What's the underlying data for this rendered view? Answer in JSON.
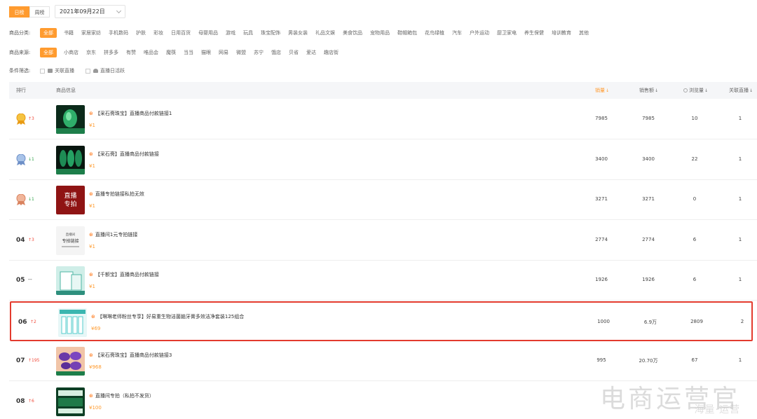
{
  "period": {
    "daily": "日榜",
    "weekly": "周榜"
  },
  "date": {
    "value": "2021年09月22日"
  },
  "category": {
    "label": "商品分类:",
    "items": [
      "全部",
      "书籍",
      "家居家纺",
      "手机数码",
      "护肤",
      "彩妆",
      "日用百货",
      "母婴用品",
      "游戏",
      "玩具",
      "珠宝配饰",
      "男装女装",
      "礼品文娱",
      "美食饮品",
      "宠物用品",
      "鞋帽箱包",
      "花鸟绿植",
      "汽车",
      "户外运动",
      "厨卫家电",
      "养生保健",
      "培训教育",
      "其他"
    ]
  },
  "source": {
    "label": "商品来源:",
    "items": [
      "全部",
      "小商店",
      "京东",
      "拼多多",
      "有赞",
      "唯品会",
      "魔筷",
      "当当",
      "猫眼",
      "网易",
      "微盟",
      "苏宁",
      "饿店",
      "贝省",
      "爱达",
      "趣店街"
    ]
  },
  "conditions": {
    "label": "条件筛选:",
    "items": [
      "关联直播",
      "直播日活跃"
    ]
  },
  "table": {
    "headers": {
      "rank": "排行",
      "info": "商品信息",
      "sales": "销量",
      "sales_amount": "销售额",
      "views": "浏览量",
      "live": "关联直播"
    },
    "rows": [
      {
        "rank": "01",
        "medal": "gold",
        "trend": "↑3",
        "trend_dir": "up",
        "title": "【采石斋珠宝】直播商品付款链接1",
        "tagged": true,
        "price": "¥1",
        "sales": "7985",
        "amount": "7985",
        "views": "10",
        "live": "1",
        "thumb": "green-jade"
      },
      {
        "rank": "02",
        "medal": "silver",
        "trend": "↓1",
        "trend_dir": "down",
        "title": "【采石斋】直播商品付款链接",
        "tagged": true,
        "price": "¥1",
        "sales": "3400",
        "amount": "3400",
        "views": "22",
        "live": "1",
        "thumb": "green-bangles"
      },
      {
        "rank": "03",
        "medal": "bronze",
        "trend": "↓1",
        "trend_dir": "down",
        "title": "直播专拍链接私拍无效",
        "tagged": true,
        "price": "¥1",
        "sales": "3271",
        "amount": "3271",
        "views": "0",
        "live": "1",
        "thumb": "red-live"
      },
      {
        "rank": "04",
        "medal": "",
        "trend": "↑3",
        "trend_dir": "up",
        "title": "直播间1元专拍链接",
        "tagged": true,
        "price": "¥1",
        "sales": "2774",
        "amount": "2774",
        "views": "6",
        "live": "1",
        "thumb": "grey-link"
      },
      {
        "rank": "05",
        "medal": "",
        "trend": "--",
        "trend_dir": "flat",
        "title": "【千额宝】直播商品付款链接",
        "tagged": true,
        "price": "¥1",
        "sales": "1926",
        "amount": "1926",
        "views": "6",
        "live": "1",
        "thumb": "teal-box"
      },
      {
        "rank": "06",
        "medal": "",
        "trend": "↑2",
        "trend_dir": "up",
        "title": "【琳琳老师粉丝专享】好易重生物洁菌脑牙膏多效洁净套装125组合",
        "tagged": true,
        "price": "¥69",
        "sales": "1000",
        "amount": "6.9万",
        "views": "2809",
        "live": "2",
        "thumb": "toothpaste"
      },
      {
        "rank": "07",
        "medal": "",
        "trend": "↑195",
        "trend_dir": "up",
        "title": "【采石斋珠宝】直播商品付款链接3",
        "tagged": true,
        "price": "¥968",
        "sales": "995",
        "amount": "20.70万",
        "views": "67",
        "live": "1",
        "thumb": "purple-stones"
      },
      {
        "rank": "08",
        "medal": "",
        "trend": "↑6",
        "trend_dir": "up",
        "title": "直播间专拍（私拍不发货）",
        "tagged": true,
        "price": "¥100",
        "sales": "",
        "amount": "",
        "views": "",
        "live": "",
        "thumb": "green-banner"
      }
    ]
  },
  "thumb_text": {
    "red_live_1": "直播",
    "red_live_2": "专拍",
    "grey_link_top": "直播间",
    "grey_link_main": "专拍链接"
  },
  "watermark": {
    "main": "电商运营官",
    "sub": "海量·运营"
  },
  "colors": {
    "accent": "#ff9b2f",
    "highlight_border": "#e33b2e",
    "up": "#f04a3a",
    "down": "#2ba245"
  }
}
